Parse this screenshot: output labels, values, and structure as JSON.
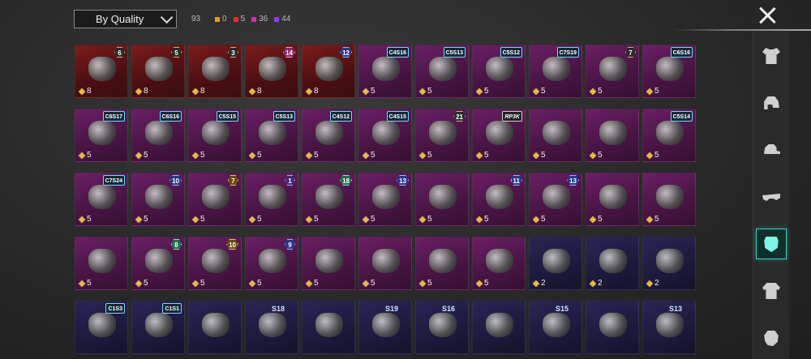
{
  "topbar": {
    "sort_label": "By Quality",
    "total": "93",
    "stats": [
      {
        "color": "#e0a020",
        "value": "0"
      },
      {
        "color": "#e03030",
        "value": "5"
      },
      {
        "color": "#d030b0",
        "value": "36"
      },
      {
        "color": "#8a40e0",
        "value": "44"
      }
    ]
  },
  "sidebar": [
    {
      "name": "shirt-icon",
      "glyph": "g-shirt",
      "active": false
    },
    {
      "name": "helmet-icon",
      "glyph": "g-helmet",
      "active": false
    },
    {
      "name": "cap-icon",
      "glyph": "g-cap",
      "active": false
    },
    {
      "name": "glasses-icon",
      "glyph": "g-glasses",
      "active": false
    },
    {
      "name": "mask-icon",
      "glyph": "g-mask",
      "active": true
    },
    {
      "name": "jacket-icon",
      "glyph": "g-jacket",
      "active": false
    },
    {
      "name": "head-icon",
      "glyph": "g-head",
      "active": false
    }
  ],
  "items": [
    {
      "rarity": "red",
      "badge": "6",
      "badge_style": "",
      "count": "8"
    },
    {
      "rarity": "red",
      "badge": "5",
      "badge_style": "",
      "count": "8"
    },
    {
      "rarity": "red",
      "badge": "3",
      "badge_style": "",
      "count": "8"
    },
    {
      "rarity": "red",
      "badge": "14",
      "badge_style": "rank-pink",
      "count": "8"
    },
    {
      "rarity": "red",
      "badge": "12",
      "badge_style": "rank-blue",
      "count": "8"
    },
    {
      "rarity": "purple",
      "badge": "C4S16",
      "badge_style": "season",
      "count": "5"
    },
    {
      "rarity": "purple",
      "badge": "C5S13",
      "badge_style": "season",
      "count": "5"
    },
    {
      "rarity": "purple",
      "badge": "C5S12",
      "badge_style": "season",
      "count": "5"
    },
    {
      "rarity": "purple",
      "badge": "C7S19",
      "badge_style": "season",
      "count": "5"
    },
    {
      "rarity": "purple",
      "badge": "7",
      "badge_style": "",
      "count": "5"
    },
    {
      "rarity": "purple",
      "badge": "C6S16",
      "badge_style": "season",
      "count": "5"
    },
    {
      "rarity": "purple",
      "badge": "C6S17",
      "badge_style": "season",
      "count": "5"
    },
    {
      "rarity": "purple",
      "badge": "C6S16",
      "badge_style": "season",
      "count": "5"
    },
    {
      "rarity": "purple",
      "badge": "C5S15",
      "badge_style": "season",
      "count": "5"
    },
    {
      "rarity": "purple",
      "badge": "C5S13",
      "badge_style": "season",
      "count": "5"
    },
    {
      "rarity": "purple",
      "badge": "C4S12",
      "badge_style": "season",
      "count": "5"
    },
    {
      "rarity": "purple",
      "badge": "C4S15",
      "badge_style": "season",
      "count": "5"
    },
    {
      "rarity": "purple",
      "badge": "21",
      "badge_style": "",
      "count": "5"
    },
    {
      "rarity": "purple",
      "badge": "RP3K",
      "badge_style": "tag",
      "count": "5"
    },
    {
      "rarity": "purple",
      "badge": "",
      "badge_style": "",
      "count": "5"
    },
    {
      "rarity": "purple",
      "badge": "",
      "badge_style": "",
      "count": "5"
    },
    {
      "rarity": "purple",
      "badge": "C5S14",
      "badge_style": "season",
      "count": "5"
    },
    {
      "rarity": "purple",
      "badge": "C7S24",
      "badge_style": "season",
      "count": "5"
    },
    {
      "rarity": "purple",
      "badge": "10",
      "badge_style": "rank-blue",
      "count": "5"
    },
    {
      "rarity": "purple",
      "badge": "7",
      "badge_style": "rank-gold",
      "count": "5"
    },
    {
      "rarity": "purple",
      "badge": "1",
      "badge_style": "rank-purple",
      "count": "5"
    },
    {
      "rarity": "purple",
      "badge": "18",
      "badge_style": "rank-green",
      "count": "5"
    },
    {
      "rarity": "purple",
      "badge": "13",
      "badge_style": "rank-blue",
      "count": "5"
    },
    {
      "rarity": "purple",
      "badge": "",
      "badge_style": "",
      "count": "5"
    },
    {
      "rarity": "purple",
      "badge": "11",
      "badge_style": "rank-blue",
      "count": "5"
    },
    {
      "rarity": "purple",
      "badge": "13",
      "badge_style": "rank-blue",
      "count": "5"
    },
    {
      "rarity": "purple",
      "badge": "",
      "badge_style": "",
      "count": "5"
    },
    {
      "rarity": "purple",
      "badge": "",
      "badge_style": "",
      "count": "5"
    },
    {
      "rarity": "purple",
      "badge": "",
      "badge_style": "",
      "count": "5"
    },
    {
      "rarity": "purple",
      "badge": "8",
      "badge_style": "rank-green",
      "count": "5"
    },
    {
      "rarity": "purple",
      "badge": "10",
      "badge_style": "rank-gold",
      "count": "5"
    },
    {
      "rarity": "purple",
      "badge": "9",
      "badge_style": "rank-blue",
      "count": "5"
    },
    {
      "rarity": "purple",
      "badge": "",
      "badge_style": "",
      "count": "5"
    },
    {
      "rarity": "purple",
      "badge": "",
      "badge_style": "",
      "count": "5"
    },
    {
      "rarity": "purple",
      "badge": "",
      "badge_style": "",
      "count": "5"
    },
    {
      "rarity": "purple",
      "badge": "",
      "badge_style": "",
      "count": "5"
    },
    {
      "rarity": "blue",
      "badge": "",
      "badge_style": "",
      "count": "2"
    },
    {
      "rarity": "blue",
      "badge": "",
      "badge_style": "",
      "count": "2"
    },
    {
      "rarity": "blue",
      "badge": "",
      "badge_style": "",
      "count": "2"
    },
    {
      "rarity": "blue",
      "badge": "C1S3",
      "badge_style": "season",
      "count": ""
    },
    {
      "rarity": "blue",
      "badge": "C1S1",
      "badge_style": "season",
      "count": ""
    },
    {
      "rarity": "blue",
      "badge": "",
      "badge_style": "",
      "count": ""
    },
    {
      "rarity": "blue",
      "badge": "S18",
      "badge_style": "tier",
      "count": ""
    },
    {
      "rarity": "blue",
      "badge": "",
      "badge_style": "",
      "count": ""
    },
    {
      "rarity": "blue",
      "badge": "S19",
      "badge_style": "tier",
      "count": ""
    },
    {
      "rarity": "blue",
      "badge": "S16",
      "badge_style": "tier",
      "count": ""
    },
    {
      "rarity": "blue",
      "badge": "",
      "badge_style": "",
      "count": ""
    },
    {
      "rarity": "blue",
      "badge": "S15",
      "badge_style": "tier",
      "count": ""
    },
    {
      "rarity": "blue",
      "badge": "",
      "badge_style": "",
      "count": ""
    },
    {
      "rarity": "blue",
      "badge": "S13",
      "badge_style": "tier",
      "count": ""
    }
  ]
}
